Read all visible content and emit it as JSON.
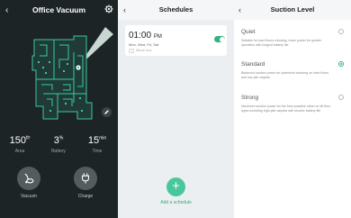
{
  "home": {
    "title": "Office Vacuum",
    "stats": [
      {
        "value": "150",
        "unit": "ft²",
        "label": "Area"
      },
      {
        "value": "3",
        "unit": "%",
        "label": "Battery"
      },
      {
        "value": "15",
        "unit": "min",
        "label": "Time"
      }
    ],
    "vacuum_label": "Vacuum",
    "charge_label": "Charge",
    "accent": "#3bc9a0"
  },
  "schedules": {
    "title": "Schedules",
    "item": {
      "time": "01:00",
      "ampm": "PM",
      "days": "Mon, Wed, Fri, Sat",
      "map": "Whole floor",
      "enabled": true
    },
    "add_label": "Add a schedule",
    "accent": "#49c79a"
  },
  "suction": {
    "title": "Suction Level",
    "options": [
      {
        "name": "Quiet",
        "desc": "Suitable for hard floors cleaning, lower power for quieter operation with longest battery life",
        "selected": false
      },
      {
        "name": "Standard",
        "desc": "Balanced suction power for optimized cleaning on hard floors and low-pile carpets",
        "selected": true
      },
      {
        "name": "Strong",
        "desc": "Maximum suction power for the best possible clean on all floor types including high-pile carpets with shorter battery life",
        "selected": false
      }
    ]
  }
}
